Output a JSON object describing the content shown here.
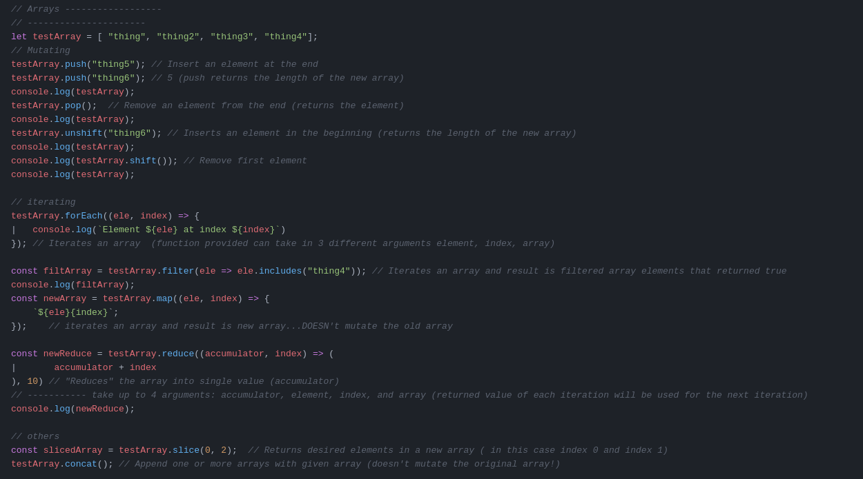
{
  "editor": {
    "background": "#1e2228",
    "lines": [
      {
        "id": 1,
        "content": "// Arrays ------------------"
      },
      {
        "id": 2,
        "content": "// ----------------------"
      },
      {
        "id": 3,
        "content": "let testArray = [ \"thing\", \"thing2\", \"thing3\", \"thing4\"];"
      },
      {
        "id": 4,
        "content": "// Mutating"
      },
      {
        "id": 5,
        "content": "testArray.push(\"thing5\"); // Insert an element at the end"
      },
      {
        "id": 6,
        "content": "testArray.push(\"thing6\"); // 5 (push returns the length of the new array)"
      },
      {
        "id": 7,
        "content": "console.log(testArray);"
      },
      {
        "id": 8,
        "content": "testArray.pop();  // Remove an element from the end (returns the element)"
      },
      {
        "id": 9,
        "content": "console.log(testArray);"
      },
      {
        "id": 10,
        "content": "testArray.unshift(\"thing6\"); // Inserts an element in the beginning (returns the length of the new array)"
      },
      {
        "id": 11,
        "content": "console.log(testArray);"
      },
      {
        "id": 12,
        "content": "console.log(testArray.shift()); // Remove first element"
      },
      {
        "id": 13,
        "content": "console.log(testArray);"
      },
      {
        "id": 14,
        "content": ""
      },
      {
        "id": 15,
        "content": "// iterating"
      },
      {
        "id": 16,
        "content": "testArray.forEach((ele, index) => {"
      },
      {
        "id": 17,
        "content": "    console.log(`Element ${ele} at index ${index}`)"
      },
      {
        "id": 18,
        "content": "}); // Iterates an array  (function provided can take in 3 different arguments element, index, array)"
      },
      {
        "id": 19,
        "content": ""
      },
      {
        "id": 20,
        "content": "const filtArray = testArray.filter(ele => ele.includes(\"thing4\")); // Iterates an array and result is filtered array elements that returned true"
      },
      {
        "id": 21,
        "content": "console.log(filtArray);"
      },
      {
        "id": 22,
        "content": "const newArray = testArray.map((ele, index) => {"
      },
      {
        "id": 23,
        "content": "    `${ele}{index}`;"
      },
      {
        "id": 24,
        "content": "});    // iterates an array and result is new array...DOESN't mutate the old array"
      },
      {
        "id": 25,
        "content": ""
      },
      {
        "id": 26,
        "content": "const newReduce = testArray.reduce((accumulator, index) => ("
      },
      {
        "id": 27,
        "content": "        accumulator + index"
      },
      {
        "id": 28,
        "content": "), 10) // \"Reduces\" the array into single value (accumulator)"
      },
      {
        "id": 29,
        "content": "// ----------- take up to 4 arguments: accumulator, element, index, and array (returned value of each iteration will be used for the next iteration)"
      },
      {
        "id": 30,
        "content": "console.log(newReduce);"
      },
      {
        "id": 31,
        "content": ""
      },
      {
        "id": 32,
        "content": "// others"
      },
      {
        "id": 33,
        "content": "const slicedArray = testArray.slice(0, 2);  // Returns desired elements in a new array ( in this case index 0 and index 1)"
      },
      {
        "id": 34,
        "content": "testArray.concat(); // Append one or more arrays with given array (doesn't mutate the original array!)"
      }
    ]
  }
}
